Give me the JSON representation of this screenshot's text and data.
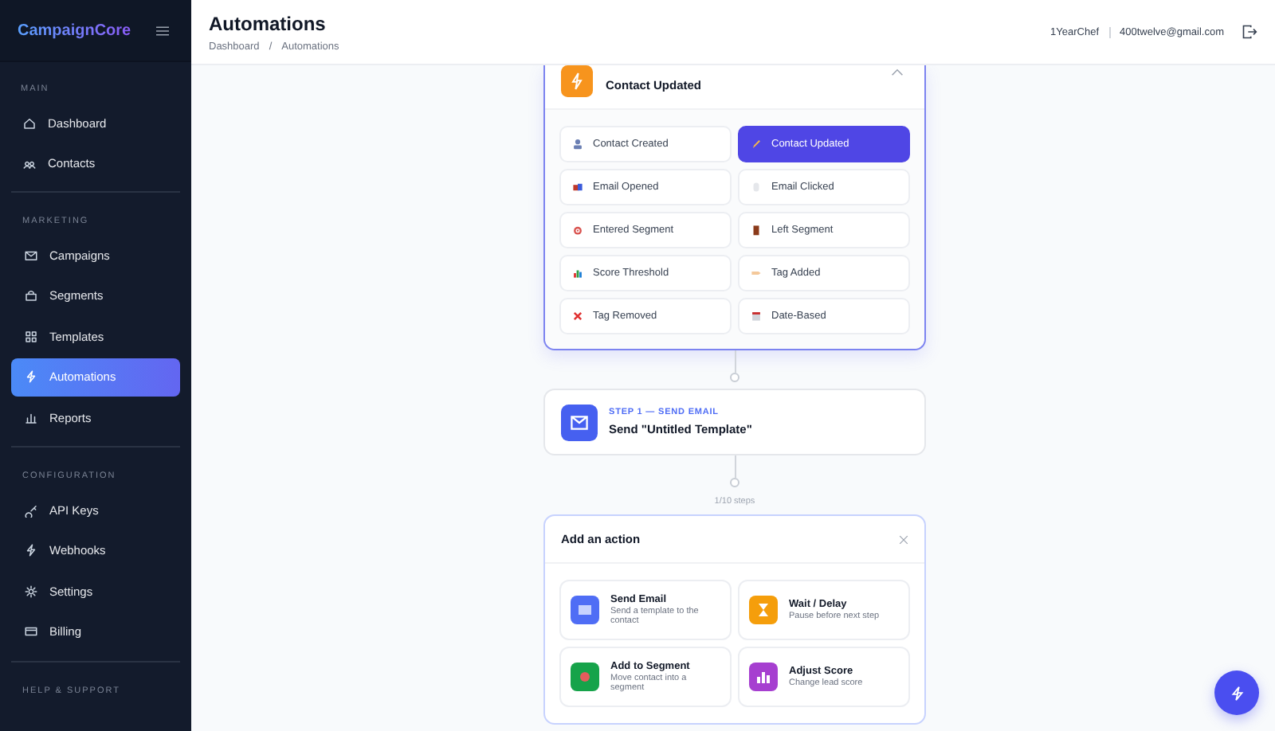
{
  "sidebar": {
    "logo": "CampaignCore",
    "sections": [
      {
        "title": "MAIN",
        "items": [
          {
            "label": "Dashboard",
            "selected": false
          },
          {
            "label": "Contacts",
            "selected": false
          }
        ]
      },
      {
        "title": "MARKETING",
        "items": [
          {
            "label": "Campaigns",
            "selected": false
          },
          {
            "label": "Segments",
            "selected": false
          },
          {
            "label": "Templates",
            "selected": false
          },
          {
            "label": "Automations",
            "selected": true
          },
          {
            "label": "Reports",
            "selected": false
          }
        ]
      },
      {
        "title": "CONFIGURATION",
        "items": [
          {
            "label": "API Keys",
            "selected": false
          },
          {
            "label": "Webhooks",
            "selected": false
          },
          {
            "label": "Settings",
            "selected": false
          },
          {
            "label": "Billing",
            "selected": false
          }
        ]
      },
      {
        "title": "HELP & SUPPORT"
      }
    ]
  },
  "header": {
    "title": "Automations",
    "breadcrumbs": [
      "Dashboard",
      "Automations"
    ],
    "separator": "/",
    "user": "1YearChef",
    "email": "400twelve@gmail.com"
  },
  "trigger": {
    "title": "Contact Updated",
    "expanded": true,
    "options": [
      {
        "label": "Contact Created",
        "selected": false
      },
      {
        "label": "Contact Updated",
        "selected": true
      },
      {
        "label": "Email Opened",
        "selected": false
      },
      {
        "label": "Email Clicked",
        "selected": false
      },
      {
        "label": "Entered Segment",
        "selected": false
      },
      {
        "label": "Left Segment",
        "selected": false
      },
      {
        "label": "Score Threshold",
        "selected": false
      },
      {
        "label": "Tag Added",
        "selected": false
      },
      {
        "label": "Tag Removed",
        "selected": false
      },
      {
        "label": "Date-Based",
        "selected": false
      }
    ]
  },
  "step": {
    "label": "STEP 1 — SEND EMAIL",
    "title": "Send \"Untitled Template\""
  },
  "steps_count": "1/10 steps",
  "add_action": {
    "title": "Add an action",
    "actions": [
      {
        "title": "Send Email",
        "description": "Send a template to the contact"
      },
      {
        "title": "Wait / Delay",
        "description": "Pause before next step"
      },
      {
        "title": "Add to Segment",
        "description": "Move contact into a segment"
      },
      {
        "title": "Adjust Score",
        "description": "Change lead score"
      }
    ]
  }
}
